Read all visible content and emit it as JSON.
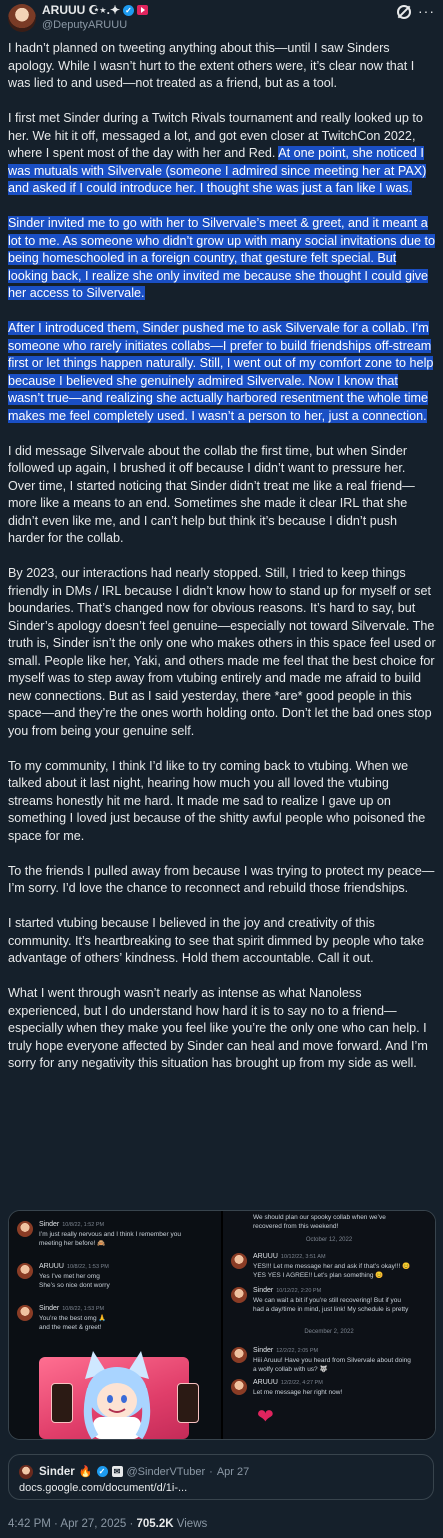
{
  "author": {
    "name": "ARUUU",
    "name_decor": "☪︎⋆.✦",
    "handle": "@DeputyARUUU"
  },
  "icons": {
    "verified": "verified-badge-icon",
    "flag": "youtube-flag-icon",
    "grok": "grok-icon",
    "more": "more-icon"
  },
  "paragraphs": [
    {
      "parts": [
        {
          "t": "I hadn’t planned on tweeting anything about this—until I saw Sinders apology. While I wasn’t hurt to the extent others were, it’s clear now that I was lied to and used—not treated as a friend, but as a tool.",
          "hl": false
        }
      ]
    },
    {
      "parts": [
        {
          "t": "I first met Sinder during a Twitch Rivals tournament and really looked up to her. We hit it off, messaged a lot, and got even closer at TwitchCon 2022, where I spent most of the day with her and Red. ",
          "hl": false
        },
        {
          "t": "At one point, she noticed I was mutuals with Silvervale (someone I admired since meeting her at PAX) and asked if I could introduce her. I thought she was just a fan like I was.",
          "hl": true
        }
      ]
    },
    {
      "parts": [
        {
          "t": "Sinder invited me to go with her to Silvervale’s meet & greet, and it meant a lot to me. As someone who didn’t grow up with many social invitations due to being homeschooled in a foreign country, that gesture felt special. But looking back, I realize she only invited me because she thought I could give her access to Silvervale.",
          "hl": true
        }
      ]
    },
    {
      "parts": [
        {
          "t": "After I introduced them, Sinder pushed me to ask Silvervale for a collab. I’m someone who rarely initiates collabs—I prefer to build friendships off-stream first or let things happen naturally. Still, I went out of my comfort zone to help because I believed she genuinely admired Silvervale. Now I know that wasn’t true—and realizing she actually harbored resentment the whole time makes me feel completely used. I wasn’t a person to her, just a connection.",
          "hl": true
        }
      ]
    },
    {
      "parts": [
        {
          "t": "I did message Silvervale about the collab the first time, but when Sinder followed up again, I brushed it off because I didn’t want to pressure her. Over time, I started noticing that Sinder didn’t treat me like a real friend—more like a means to an end. Sometimes she made it clear IRL that she didn’t even like me, and I can’t help but think it’s because I didn’t push harder for the collab.",
          "hl": false
        }
      ]
    },
    {
      "parts": [
        {
          "t": "By 2023, our interactions had nearly stopped. Still, I tried to keep things friendly in DMs / IRL because I didn’t know how to stand up for myself or set boundaries. That’s changed now for obvious reasons. It’s hard to say, but Sinder’s apology doesn’t feel genuine—especially not toward Silvervale. The truth is, Sinder isn’t the only one who makes others in this space feel used or small. People like her, Yaki, and others made me feel that the best choice for myself was to step away from vtubing entirely and made me afraid to build new connections. But as I said yesterday, there *are* good people in this space—and they’re the ones worth holding onto. Don’t let the bad ones stop you from being your genuine self.",
          "hl": false
        }
      ]
    },
    {
      "parts": [
        {
          "t": "To my community, I think I’d like to try coming back to vtubing. When we talked about it last night, hearing how much you all loved the vtubing streams honestly hit me hard. It made me sad to realize I gave up on something I loved just because of the shitty awful people who poisoned the space for me.",
          "hl": false
        }
      ]
    },
    {
      "parts": [
        {
          "t": "To the friends I pulled away from because I was trying to protect my peace—I’m sorry. I’d love the chance to reconnect and rebuild those friendships.",
          "hl": false
        }
      ]
    },
    {
      "parts": [
        {
          "t": "I started vtubing because I believed in the joy and creativity of this community. It’s heartbreaking to see that spirit dimmed by people who take advantage of others’ kindness. Hold them accountable. Call it out.",
          "hl": false
        }
      ]
    },
    {
      "parts": [
        {
          "t": "What I went through wasn’t nearly as intense as what Nanoless experienced, but I do understand how hard it is to say no to a friend—especially when they make you feel like you’re the only one who can help. I truly hope everyone affected by Sinder can heal and move forward. And I’m sorry for any negativity this situation has brought up from my side as well.",
          "hl": false
        }
      ]
    }
  ],
  "media": {
    "left": [
      {
        "user": "Sinder",
        "time": "10/8/22, 1:52 PM",
        "msg": "I’m just really nervous and I think I remember you",
        "msg2": "meeting her before! 🙈"
      },
      {
        "user": "ARUUU",
        "time": "10/8/22, 1:53 PM",
        "msg": "Yes I’ve met her omg",
        "msg2": "She’s so nice dont worry"
      },
      {
        "user": "Sinder",
        "time": "10/8/22, 1:53 PM",
        "msg": "You’re the best omg 🙏",
        "msg2": "and the meet & greet!"
      }
    ],
    "right": {
      "top_msg": "We should plan our spooky collab when we’ve",
      "top_msg2": "recovered from this weekend!",
      "date1": "October 12, 2022",
      "msgs": [
        {
          "user": "ARUUU",
          "time": "10/12/22, 3:51 AM",
          "msg": "YES!!! Let me message her and ask if that’s okay!!! 😊",
          "msg2": "YES YES I AGREE!! Let’s plan something 😊"
        },
        {
          "user": "Sinder",
          "time": "10/12/22, 2:20 PM",
          "msg": "We can wait a bit if you’re still recovering! But if you",
          "msg2": "had a day/time in mind, just link! My schedule is pretty"
        }
      ],
      "date2": "December 2, 2022",
      "msgs2": [
        {
          "user": "Sinder",
          "time": "12/2/22, 2:05 PM",
          "msg": "Hiii Aruuu! Have you heard from Silvervale about doing",
          "msg2": "a wolfy collab with us? 🐺"
        },
        {
          "user": "ARUUU",
          "time": "12/2/22, 4:27 PM",
          "msg": "Let me message her right now!",
          "msg2": ""
        }
      ],
      "heart": "❤"
    }
  },
  "quote": {
    "name": "Sinder",
    "handle": "@SinderVTuber",
    "date": "Apr 27",
    "link": "docs.google.com/document/d/1i-...",
    "fire": "🔥"
  },
  "footer": {
    "time": "4:42 PM · Apr 27, 2025 · ",
    "views": "705.2K",
    "views_label": " Views"
  }
}
